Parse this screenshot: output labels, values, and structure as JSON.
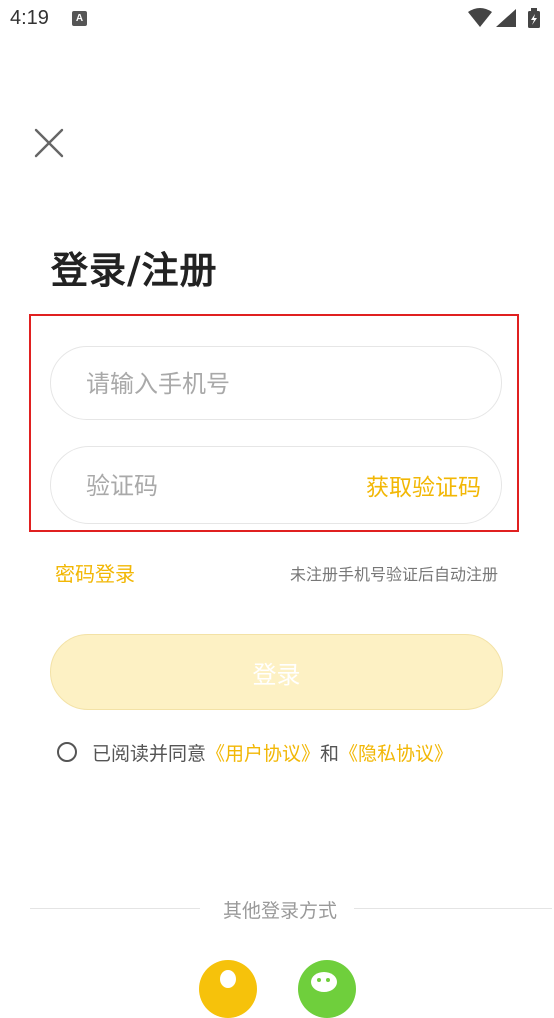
{
  "status_bar": {
    "time": "4:19",
    "notification_glyph": "A"
  },
  "page": {
    "title": "登录/注册",
    "phone_placeholder": "请输入手机号",
    "code_placeholder": "验证码",
    "get_code_label": "获取验证码",
    "password_login_label": "密码登录",
    "auto_register_note": "未注册手机号验证后自动注册",
    "login_button_label": "登录",
    "agreement": {
      "prefix": "已阅读并同意",
      "user_agreement": "《用户协议》",
      "conjunction": "和",
      "privacy_policy": "《隐私协议》"
    },
    "other_login_label": "其他登录方式"
  },
  "colors": {
    "accent": "#f2b705",
    "login_button_bg": "#fdf1c4",
    "highlight_border": "#e02020"
  },
  "icons": {
    "close": "close-icon",
    "wifi": "wifi-icon",
    "signal": "signal-icon",
    "battery": "battery-icon",
    "social_1": "qq-login-icon",
    "social_2": "wechat-login-icon"
  }
}
